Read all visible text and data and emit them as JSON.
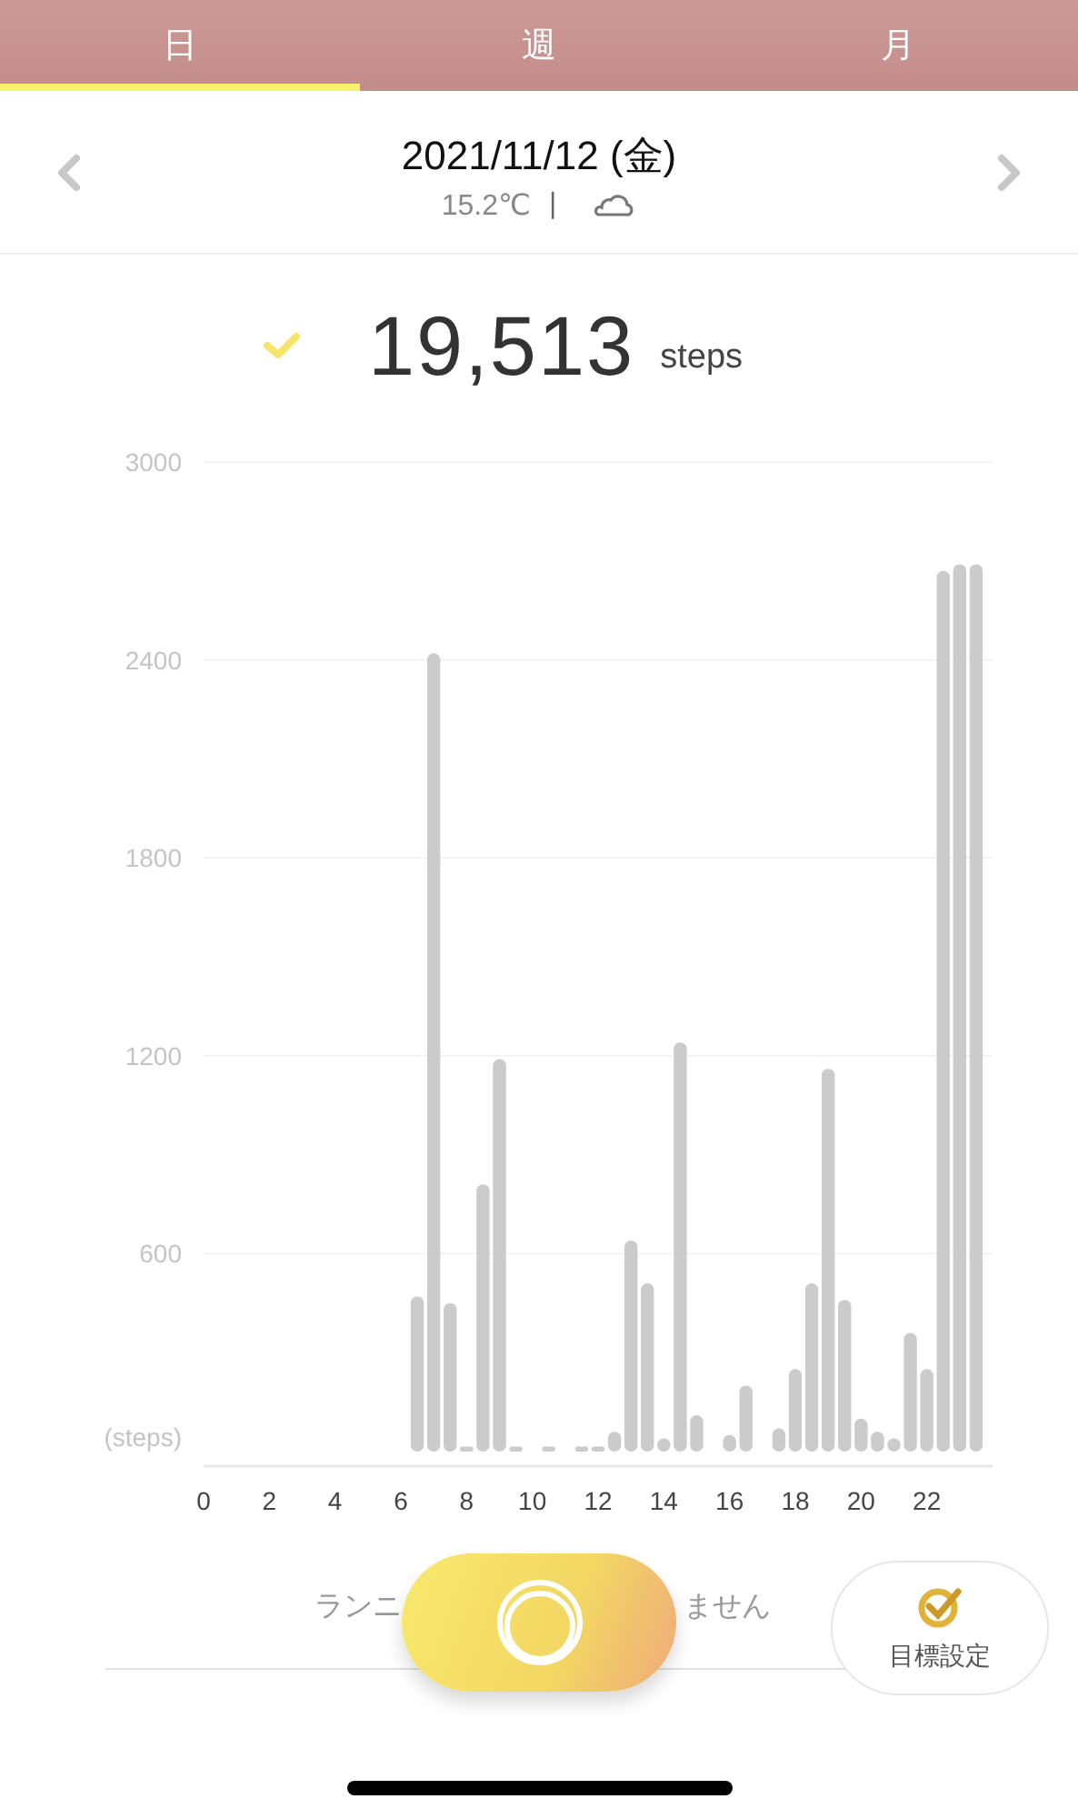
{
  "tabs": [
    {
      "label": "日",
      "selected": true
    },
    {
      "label": "週",
      "selected": false
    },
    {
      "label": "月",
      "selected": false
    }
  ],
  "day_header": {
    "date": "2021/11/12 (金)",
    "temperature": "15.2℃",
    "separator": "|"
  },
  "summary": {
    "goal_reached": true,
    "steps": "19,513",
    "unit": "steps"
  },
  "chart": {
    "chart_data": {
      "type": "bar",
      "x": [
        6.5,
        7,
        7.5,
        8,
        8.5,
        9,
        9.5,
        10.5,
        11.5,
        12,
        12.5,
        13,
        13.5,
        14,
        14.5,
        15,
        16,
        16.5,
        17.5,
        18,
        18.5,
        19,
        19.5,
        20,
        20.5,
        21,
        21.5,
        22,
        22.5,
        23,
        23.5
      ],
      "values": [
        470,
        2420,
        450,
        15,
        810,
        1190,
        15,
        15,
        15,
        15,
        60,
        640,
        510,
        40,
        1240,
        110,
        50,
        200,
        70,
        250,
        510,
        1160,
        460,
        100,
        60,
        40,
        360,
        250,
        2670,
        2690,
        2690
      ],
      "xlim": [
        0,
        24
      ],
      "ylim": [
        0,
        3000
      ],
      "grid": true,
      "xticks": [
        0,
        2,
        4,
        6,
        8,
        10,
        12,
        14,
        16,
        18,
        20,
        22
      ],
      "yticks": [
        {
          "value": 0,
          "label": "(steps)"
        },
        600,
        1200,
        1800,
        2400,
        3000
      ]
    }
  },
  "bottom": {
    "message_parts": [
      "ランニ",
      "ません"
    ],
    "goal_button": "目標設定"
  }
}
